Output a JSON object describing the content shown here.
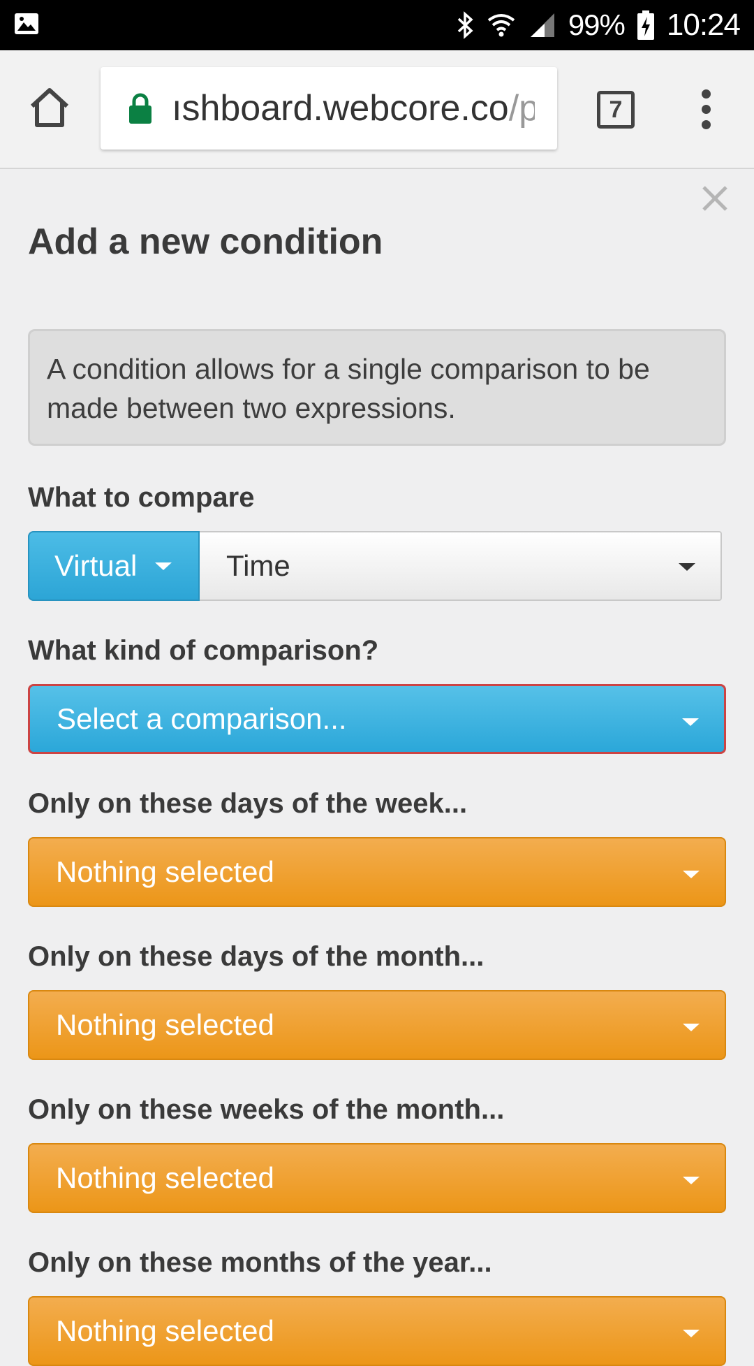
{
  "status_bar": {
    "battery": "99%",
    "time": "10:24",
    "icons": [
      "image-icon",
      "bluetooth-icon",
      "wifi-icon",
      "signal-icon",
      "battery-charging-icon"
    ]
  },
  "browser": {
    "url_main": "ıshboard.webcore.co",
    "url_dim": "/p",
    "tab_count": "7"
  },
  "dialog": {
    "title": "Add a new condition",
    "info": "A condition allows for a single comparison to be made between two expressions.",
    "compare_label": "What to compare",
    "virtual_label": "Virtual",
    "compare_value": "Time",
    "comparison_label": "What kind of comparison?",
    "comparison_placeholder": "Select a comparison...",
    "filters": [
      {
        "label": "Only on these days of the week...",
        "value": "Nothing selected"
      },
      {
        "label": "Only on these days of the month...",
        "value": "Nothing selected"
      },
      {
        "label": "Only on these weeks of the month...",
        "value": "Nothing selected"
      },
      {
        "label": "Only on these months of the year...",
        "value": "Nothing selected"
      }
    ]
  },
  "colors": {
    "accent_blue": "#2ba7d9",
    "accent_orange": "#ec9618",
    "error_border": "#cc4444"
  }
}
